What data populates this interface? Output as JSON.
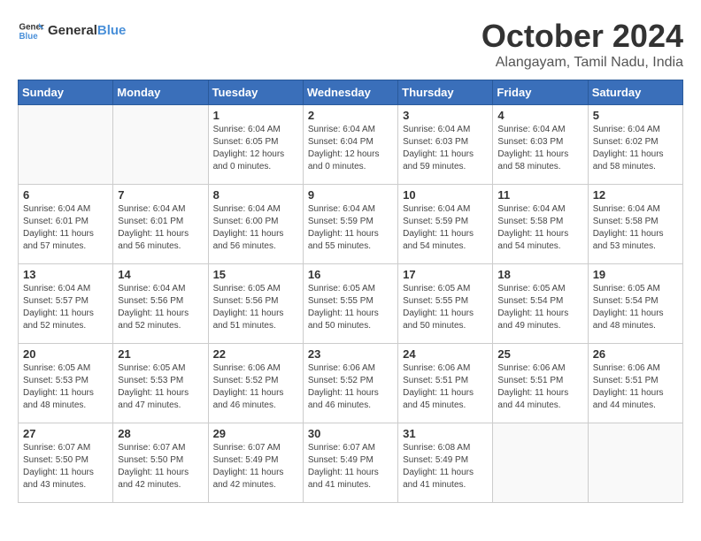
{
  "logo": {
    "general": "General",
    "blue": "Blue"
  },
  "title": "October 2024",
  "subtitle": "Alangayam, Tamil Nadu, India",
  "headers": [
    "Sunday",
    "Monday",
    "Tuesday",
    "Wednesday",
    "Thursday",
    "Friday",
    "Saturday"
  ],
  "weeks": [
    [
      {
        "day": "",
        "info": ""
      },
      {
        "day": "",
        "info": ""
      },
      {
        "day": "1",
        "info": "Sunrise: 6:04 AM\nSunset: 6:05 PM\nDaylight: 12 hours\nand 0 minutes."
      },
      {
        "day": "2",
        "info": "Sunrise: 6:04 AM\nSunset: 6:04 PM\nDaylight: 12 hours\nand 0 minutes."
      },
      {
        "day": "3",
        "info": "Sunrise: 6:04 AM\nSunset: 6:03 PM\nDaylight: 11 hours\nand 59 minutes."
      },
      {
        "day": "4",
        "info": "Sunrise: 6:04 AM\nSunset: 6:03 PM\nDaylight: 11 hours\nand 58 minutes."
      },
      {
        "day": "5",
        "info": "Sunrise: 6:04 AM\nSunset: 6:02 PM\nDaylight: 11 hours\nand 58 minutes."
      }
    ],
    [
      {
        "day": "6",
        "info": "Sunrise: 6:04 AM\nSunset: 6:01 PM\nDaylight: 11 hours\nand 57 minutes."
      },
      {
        "day": "7",
        "info": "Sunrise: 6:04 AM\nSunset: 6:01 PM\nDaylight: 11 hours\nand 56 minutes."
      },
      {
        "day": "8",
        "info": "Sunrise: 6:04 AM\nSunset: 6:00 PM\nDaylight: 11 hours\nand 56 minutes."
      },
      {
        "day": "9",
        "info": "Sunrise: 6:04 AM\nSunset: 5:59 PM\nDaylight: 11 hours\nand 55 minutes."
      },
      {
        "day": "10",
        "info": "Sunrise: 6:04 AM\nSunset: 5:59 PM\nDaylight: 11 hours\nand 54 minutes."
      },
      {
        "day": "11",
        "info": "Sunrise: 6:04 AM\nSunset: 5:58 PM\nDaylight: 11 hours\nand 54 minutes."
      },
      {
        "day": "12",
        "info": "Sunrise: 6:04 AM\nSunset: 5:58 PM\nDaylight: 11 hours\nand 53 minutes."
      }
    ],
    [
      {
        "day": "13",
        "info": "Sunrise: 6:04 AM\nSunset: 5:57 PM\nDaylight: 11 hours\nand 52 minutes."
      },
      {
        "day": "14",
        "info": "Sunrise: 6:04 AM\nSunset: 5:56 PM\nDaylight: 11 hours\nand 52 minutes."
      },
      {
        "day": "15",
        "info": "Sunrise: 6:05 AM\nSunset: 5:56 PM\nDaylight: 11 hours\nand 51 minutes."
      },
      {
        "day": "16",
        "info": "Sunrise: 6:05 AM\nSunset: 5:55 PM\nDaylight: 11 hours\nand 50 minutes."
      },
      {
        "day": "17",
        "info": "Sunrise: 6:05 AM\nSunset: 5:55 PM\nDaylight: 11 hours\nand 50 minutes."
      },
      {
        "day": "18",
        "info": "Sunrise: 6:05 AM\nSunset: 5:54 PM\nDaylight: 11 hours\nand 49 minutes."
      },
      {
        "day": "19",
        "info": "Sunrise: 6:05 AM\nSunset: 5:54 PM\nDaylight: 11 hours\nand 48 minutes."
      }
    ],
    [
      {
        "day": "20",
        "info": "Sunrise: 6:05 AM\nSunset: 5:53 PM\nDaylight: 11 hours\nand 48 minutes."
      },
      {
        "day": "21",
        "info": "Sunrise: 6:05 AM\nSunset: 5:53 PM\nDaylight: 11 hours\nand 47 minutes."
      },
      {
        "day": "22",
        "info": "Sunrise: 6:06 AM\nSunset: 5:52 PM\nDaylight: 11 hours\nand 46 minutes."
      },
      {
        "day": "23",
        "info": "Sunrise: 6:06 AM\nSunset: 5:52 PM\nDaylight: 11 hours\nand 46 minutes."
      },
      {
        "day": "24",
        "info": "Sunrise: 6:06 AM\nSunset: 5:51 PM\nDaylight: 11 hours\nand 45 minutes."
      },
      {
        "day": "25",
        "info": "Sunrise: 6:06 AM\nSunset: 5:51 PM\nDaylight: 11 hours\nand 44 minutes."
      },
      {
        "day": "26",
        "info": "Sunrise: 6:06 AM\nSunset: 5:51 PM\nDaylight: 11 hours\nand 44 minutes."
      }
    ],
    [
      {
        "day": "27",
        "info": "Sunrise: 6:07 AM\nSunset: 5:50 PM\nDaylight: 11 hours\nand 43 minutes."
      },
      {
        "day": "28",
        "info": "Sunrise: 6:07 AM\nSunset: 5:50 PM\nDaylight: 11 hours\nand 42 minutes."
      },
      {
        "day": "29",
        "info": "Sunrise: 6:07 AM\nSunset: 5:49 PM\nDaylight: 11 hours\nand 42 minutes."
      },
      {
        "day": "30",
        "info": "Sunrise: 6:07 AM\nSunset: 5:49 PM\nDaylight: 11 hours\nand 41 minutes."
      },
      {
        "day": "31",
        "info": "Sunrise: 6:08 AM\nSunset: 5:49 PM\nDaylight: 11 hours\nand 41 minutes."
      },
      {
        "day": "",
        "info": ""
      },
      {
        "day": "",
        "info": ""
      }
    ]
  ]
}
